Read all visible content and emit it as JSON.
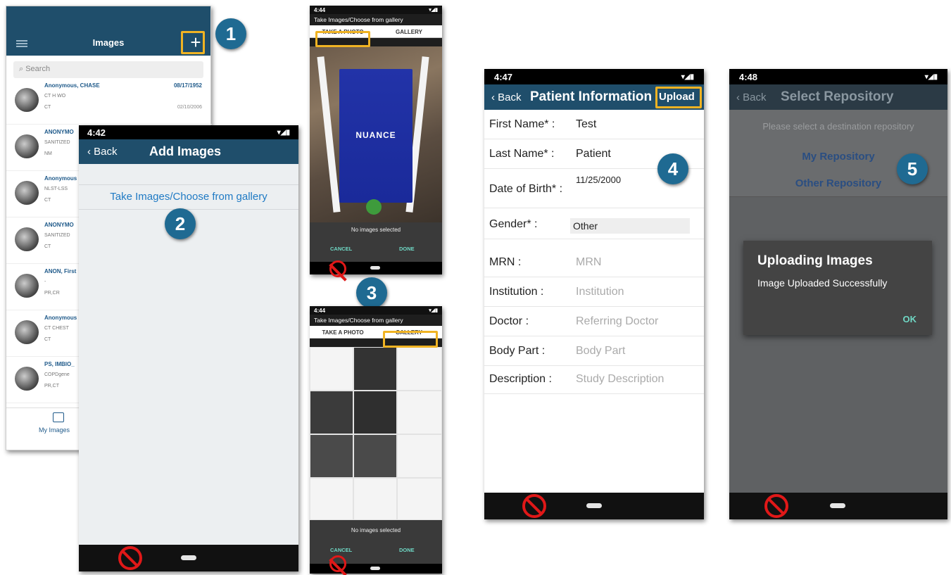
{
  "phone1": {
    "title": "Images",
    "search_placeholder": "Search",
    "rows": [
      {
        "name": "Anonymous, CHASE",
        "l2": "CT H WO",
        "l3": "CT",
        "date": "08/17/1952",
        "date2": "02/10/2006"
      },
      {
        "name": "ANONYMO",
        "l2": "SANITIZED",
        "l3": "NM",
        "date": "",
        "date2": ""
      },
      {
        "name": "Anonymous",
        "l2": "NLST-LSS",
        "l3": "CT",
        "date": "",
        "date2": ""
      },
      {
        "name": "ANONYMO",
        "l2": "SANITIZED",
        "l3": "CT",
        "date": "",
        "date2": ""
      },
      {
        "name": "ANON, First",
        "l2": "-",
        "l3": "PR,CR",
        "date": "",
        "date2": ""
      },
      {
        "name": "Anonymous",
        "l2": "CT CHEST",
        "l3": "CT",
        "date": "",
        "date2": ""
      },
      {
        "name": "PS, IMBIO_",
        "l2": "COPDgene",
        "l3": "PR,CT",
        "date": "",
        "date2": ""
      }
    ],
    "footer_label": "My Images"
  },
  "phone2": {
    "time": "4:42",
    "back": "‹ Back",
    "title": "Add Images",
    "link": "Take Images/Choose from gallery"
  },
  "phone3": {
    "time_a": "4:44",
    "time_b": "4:44",
    "header": "Take Images/Choose from gallery",
    "tab_photo": "TAKE A PHOTO",
    "tab_gallery": "GALLERY",
    "brand": "NUANCE",
    "no_images": "No images selected",
    "cancel": "CANCEL",
    "done": "DONE"
  },
  "phone4": {
    "time": "4:47",
    "back": "‹ Back",
    "title": "Patient Information",
    "upload": "Upload",
    "fields": [
      {
        "label": "First Name* :",
        "value": "Test",
        "placeholder": ""
      },
      {
        "label": "Last Name* :",
        "value": "Patient",
        "placeholder": ""
      },
      {
        "label": "Date of Birth* :",
        "value": "11/25/2000",
        "placeholder": ""
      },
      {
        "label": "Gender* :",
        "value": "Other",
        "placeholder": ""
      },
      {
        "label": "MRN :",
        "value": "",
        "placeholder": "MRN"
      },
      {
        "label": "Institution :",
        "value": "",
        "placeholder": "Institution"
      },
      {
        "label": "Doctor :",
        "value": "",
        "placeholder": "Referring Doctor"
      },
      {
        "label": "Body Part :",
        "value": "",
        "placeholder": "Body Part"
      },
      {
        "label": "Description :",
        "value": "",
        "placeholder": "Study Description"
      }
    ]
  },
  "phone5": {
    "time": "4:48",
    "back": "‹ Back",
    "title": "Select Repository",
    "subtitle": "Please select a destination repository",
    "repo1": "My Repository",
    "repo2": "Other Repository",
    "dialog_title": "Uploading Images",
    "dialog_msg": "Image Uploaded Successfully",
    "dialog_ok": "OK"
  },
  "steps": [
    "1",
    "2",
    "3",
    "4",
    "5"
  ],
  "colors": {
    "header": "#1f4e6b",
    "badge": "#1f6a92",
    "highlight": "#f0b323",
    "link": "#1f7ac4",
    "accent": "#6fd7c4"
  }
}
